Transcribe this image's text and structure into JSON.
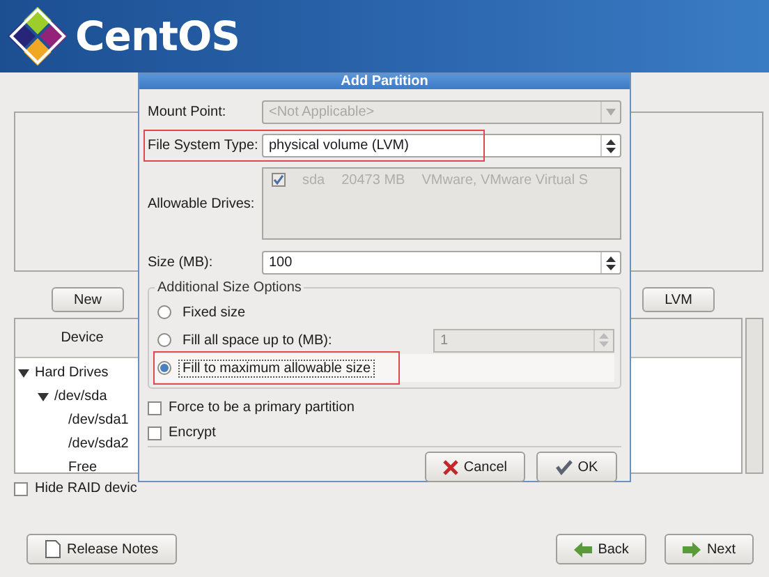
{
  "header": {
    "logo_text": "CentOS"
  },
  "partition_buttons": [
    {
      "label": "New"
    },
    {
      "label": "LVM"
    }
  ],
  "device_table": {
    "columns": [
      "Device"
    ],
    "tree": [
      {
        "label": "Hard Drives",
        "expanded": true,
        "children": [
          {
            "label": "/dev/sda",
            "expanded": true,
            "children": [
              {
                "label": "/dev/sda1"
              },
              {
                "label": "/dev/sda2"
              },
              {
                "label": "Free"
              }
            ]
          }
        ]
      }
    ]
  },
  "hide_raid": {
    "label": "Hide RAID devic",
    "checked": false
  },
  "footer_buttons": [
    {
      "label": "Release Notes",
      "kind": "notes"
    },
    {
      "label": "Back",
      "kind": "back"
    },
    {
      "label": "Next",
      "kind": "next"
    }
  ],
  "dialog": {
    "title": "Add Partition",
    "mount_point": {
      "label": "Mount Point:",
      "value": "<Not Applicable>",
      "disabled": true
    },
    "fs_type": {
      "label": "File System Type:",
      "value": "physical volume (LVM)",
      "disabled": false,
      "highlighted": true
    },
    "drives": {
      "label": "Allowable Drives:",
      "items": [
        {
          "checked": true,
          "disabled": true,
          "name": "sda",
          "size": "20473 MB",
          "model": "VMware, VMware Virtual S"
        }
      ]
    },
    "size": {
      "label": "Size (MB):",
      "value": "100"
    },
    "size_options": {
      "title": "Additional Size Options",
      "options": [
        {
          "label": "Fixed size",
          "kind": "plain",
          "selected": false,
          "highlighted": false
        },
        {
          "label": "Fill all space up to (MB):",
          "kind": "spin",
          "selected": false,
          "highlighted": false,
          "value": "1"
        },
        {
          "label": "Fill to maximum allowable size",
          "kind": "plain",
          "selected": true,
          "highlighted": true
        }
      ]
    },
    "checkboxes": [
      {
        "label": "Force to be a primary partition",
        "checked": false
      },
      {
        "label": "Encrypt",
        "checked": false
      }
    ],
    "buttons": [
      {
        "label": "Cancel",
        "kind": "cancel"
      },
      {
        "label": "OK",
        "kind": "ok"
      }
    ]
  }
}
